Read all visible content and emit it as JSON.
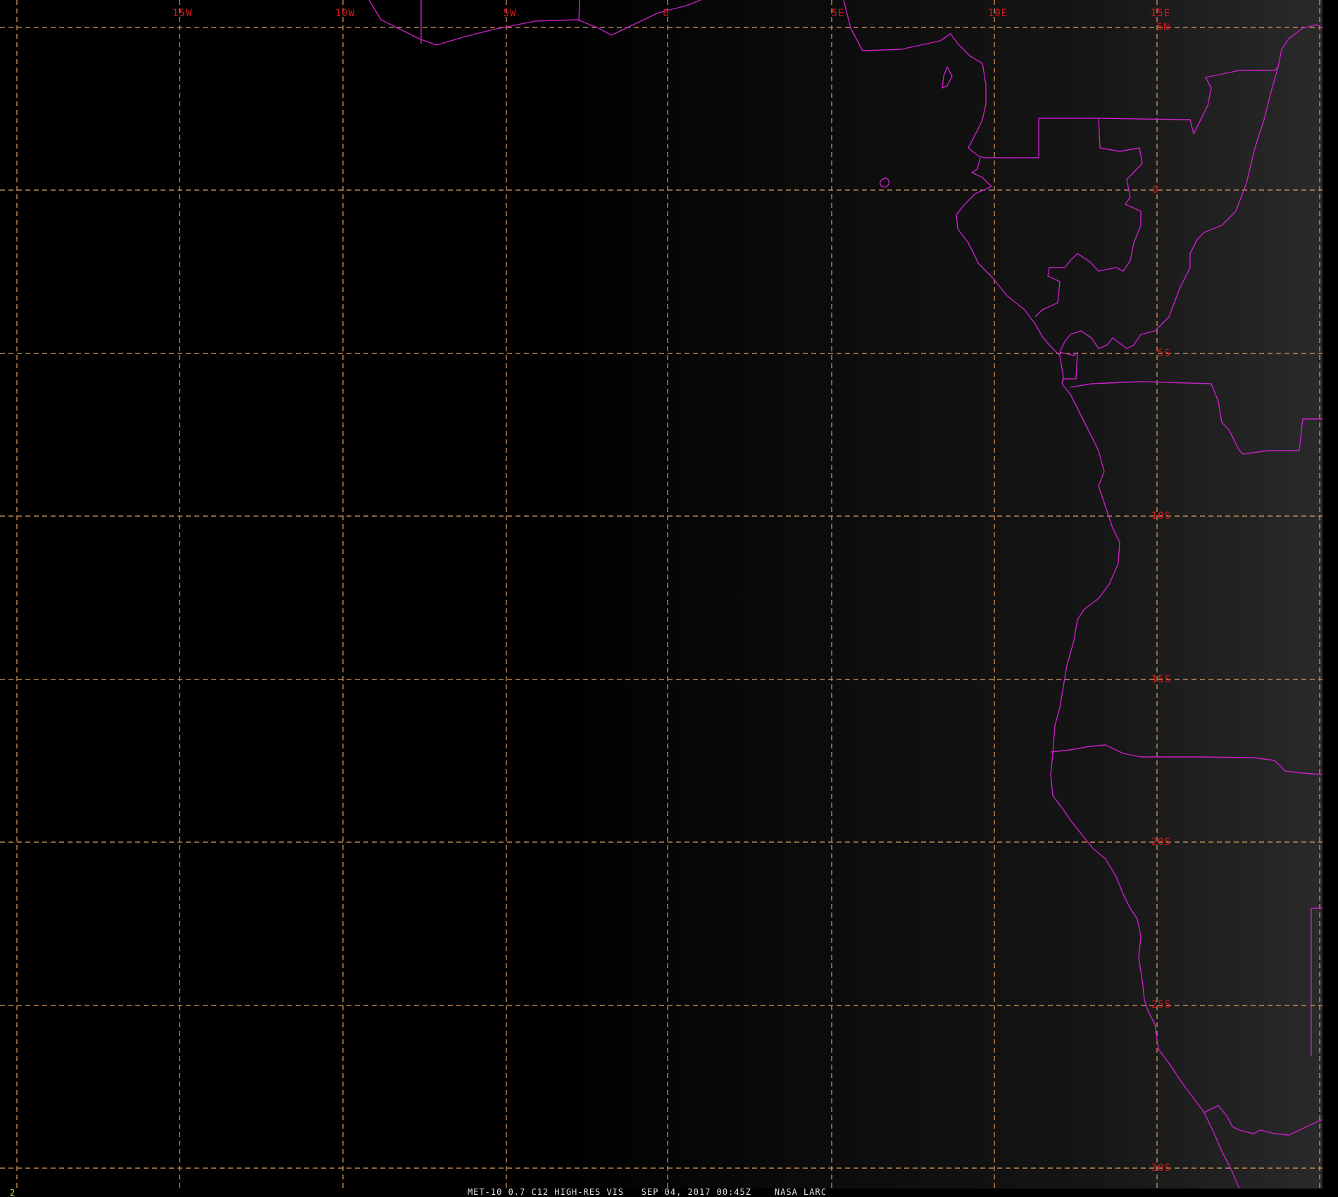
{
  "image": {
    "type": "satellite-visible",
    "frame_number": "2",
    "caption": "MET-10 0.7 C12 HIGH-RES VIS   SEP 04, 2017 00:45Z    NASA LARC",
    "colors": {
      "background": "#000000",
      "grid_lines": "#e0a060",
      "grid_labels": "#d41a1a",
      "boundaries": "#c820c8",
      "footer_text": "#e6e6e6",
      "frame_number": "#e8e020"
    }
  },
  "grid": {
    "longitude_labels": [
      "15W",
      "10W",
      "5W",
      "0",
      "5E",
      "10E",
      "15E"
    ],
    "latitude_labels": [
      "5N",
      "0",
      "5S",
      "10S",
      "15S",
      "20S",
      "25S",
      "30S"
    ]
  }
}
